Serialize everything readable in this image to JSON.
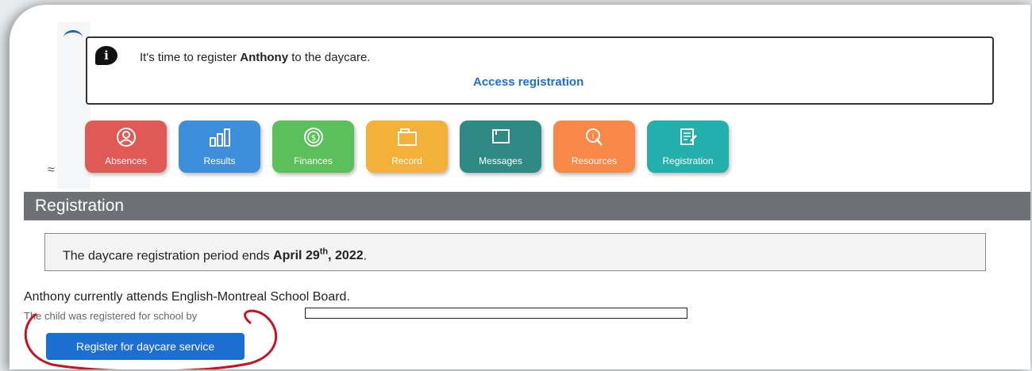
{
  "alert": {
    "icon": "info-icon",
    "message_prefix": "It's time to register ",
    "child_name": "Anthony",
    "message_suffix": " to the daycare.",
    "link": "Access registration"
  },
  "tiles": [
    {
      "label": "Absences",
      "icon": "person-circle-icon",
      "color": "#e05a55"
    },
    {
      "label": "Results",
      "icon": "bar-chart-icon",
      "color": "#3d8fdc"
    },
    {
      "label": "Finances",
      "icon": "dollar-coin-icon",
      "color": "#5bbf5a"
    },
    {
      "label": "Record",
      "icon": "folder-icon",
      "color": "#f4b13a"
    },
    {
      "label": "Messages",
      "icon": "message-icon",
      "color": "#2f8a86"
    },
    {
      "label": "Resources",
      "icon": "resources-icon",
      "color": "#f78848"
    },
    {
      "label": "Registration",
      "icon": "registration-form-icon",
      "color": "#23b0ad"
    }
  ],
  "collapse_icon": "chevron-up-double-icon",
  "section_title": "Registration",
  "period": {
    "prefix": "The daycare registration period ends ",
    "date_main": "April 29",
    "date_sup": "th",
    "date_suffix": ", 2022",
    "end": "."
  },
  "attends_text": "Anthony currently attends English-Montreal School Board.",
  "registered_by_text": "The child was registered for school by",
  "register_button": "Register for daycare service"
}
